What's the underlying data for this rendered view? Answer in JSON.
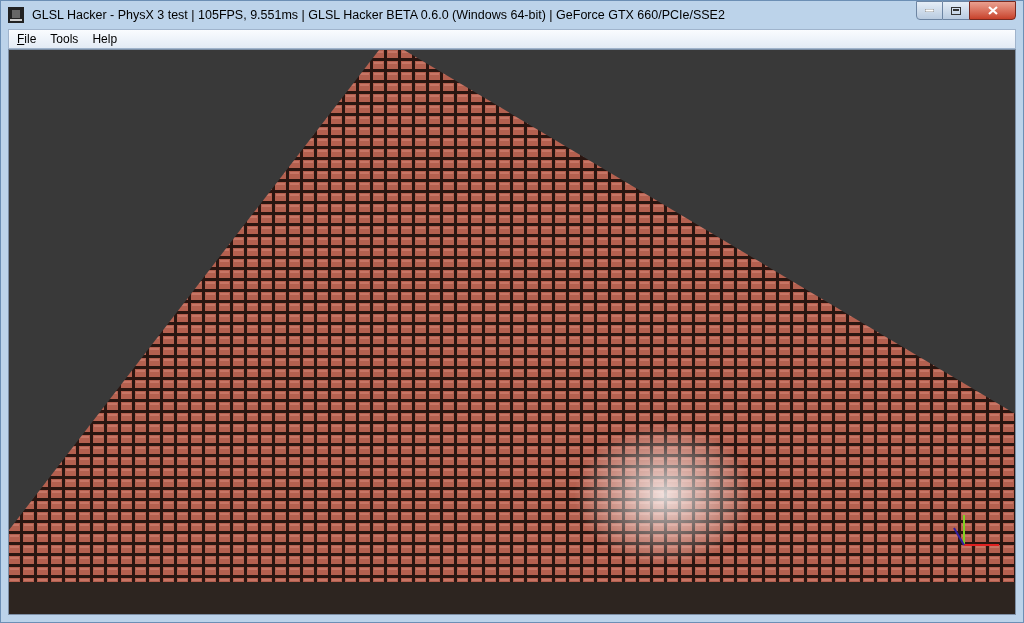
{
  "window": {
    "title": "GLSL Hacker - PhysX 3 test | 105FPS, 9.551ms | GLSL Hacker BETA 0.6.0 (Windows 64-bit) | GeForce GTX 660/PCIe/SSE2"
  },
  "menu": [
    {
      "label": "File",
      "mnemonic_underlined": true
    },
    {
      "label": "Tools",
      "mnemonic_underlined": false
    },
    {
      "label": "Help",
      "mnemonic_underlined": false
    }
  ]
}
